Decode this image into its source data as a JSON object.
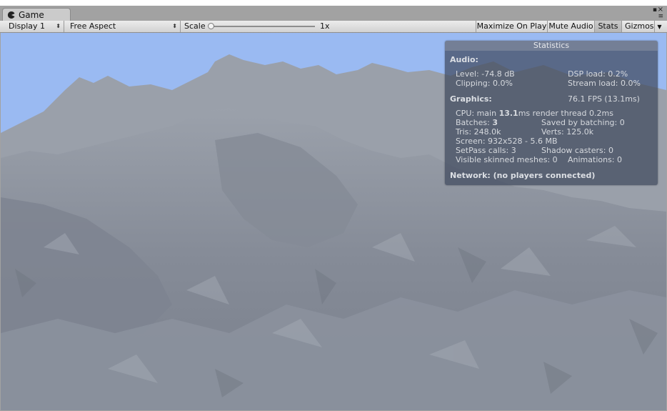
{
  "tab": {
    "label": "Game",
    "icon": "pacman-icon"
  },
  "toolbar": {
    "display": "Display 1",
    "aspect": "Free Aspect",
    "scale_label": "Scale",
    "scale_value": "1x",
    "maximize": "Maximize On Play",
    "mute": "Mute Audio",
    "stats": "Stats",
    "gizmos": "Gizmos"
  },
  "stats": {
    "title": "Statistics",
    "audio_header": "Audio:",
    "level": "Level: -74.8 dB",
    "dsp_load": "DSP load: 0.2%",
    "clipping": "Clipping: 0.0%",
    "stream_load": "Stream load: 0.0%",
    "graphics_header": "Graphics:",
    "fps": "76.1 FPS (13.1ms)",
    "cpu_prefix": "CPU: main ",
    "cpu_main": "13.1",
    "cpu_suffix": "ms  render thread 0.2ms",
    "batches_prefix": "Batches: ",
    "batches": "3",
    "saved_batching": "Saved by batching: 0",
    "tris": "Tris: 248.0k",
    "verts": "Verts: 125.0k",
    "screen": "Screen: 932x528 - 5.6 MB",
    "setpass": "SetPass calls: 3",
    "shadow": "Shadow casters: 0",
    "skinned": "Visible skinned meshes: 0",
    "animations": "Animations: 0",
    "network": "Network: (no players connected)"
  },
  "colors": {
    "sky": "#9abaf2",
    "terrain": "#8a909c",
    "panel": "#404a5e"
  }
}
